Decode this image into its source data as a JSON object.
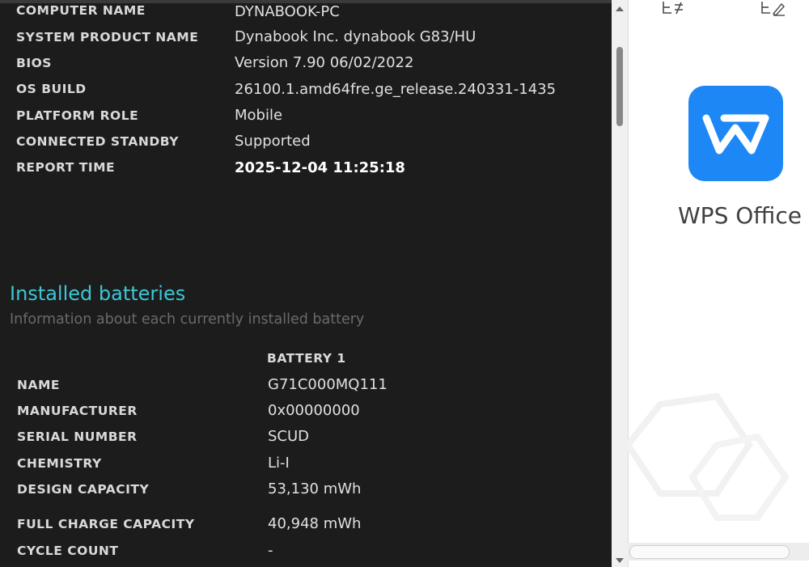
{
  "system_info": [
    {
      "label": "COMPUTER NAME",
      "value": "DYNABOOK-PC"
    },
    {
      "label": "SYSTEM PRODUCT NAME",
      "value": "Dynabook Inc. dynabook G83/HU"
    },
    {
      "label": "BIOS",
      "value": "Version 7.90 06/02/2022"
    },
    {
      "label": "OS BUILD",
      "value": "26100.1.amd64fre.ge_release.240331-1435"
    },
    {
      "label": "PLATFORM ROLE",
      "value": "Mobile"
    },
    {
      "label": "CONNECTED STANDBY",
      "value": "Supported"
    },
    {
      "label": "REPORT TIME",
      "value": "2025-12-04  11:25:18"
    }
  ],
  "batteries": {
    "title": "Installed batteries",
    "subtitle": "Information about each currently installed battery",
    "column_header": "BATTERY 1",
    "rows": [
      {
        "label": "NAME",
        "value": "G71C000MQ111"
      },
      {
        "label": "MANUFACTURER",
        "value": "0x00000000"
      },
      {
        "label": "SERIAL NUMBER",
        "value": "SCUD"
      },
      {
        "label": "CHEMISTRY",
        "value": "Li-I"
      },
      {
        "label": "DESIGN CAPACITY",
        "value": "53,130 mWh"
      },
      {
        "label": "FULL CHARGE CAPACITY",
        "value": "40,948 mWh"
      },
      {
        "label": "CYCLE COUNT",
        "value": "-"
      }
    ]
  },
  "side_panel": {
    "app_name": "WPS Office",
    "logo_color": "#1d88f5",
    "icons": [
      "edit-list-icon",
      "edit-note-icon"
    ]
  },
  "colors": {
    "background": "#1c1c1c",
    "accent": "#3ac7d8",
    "subtitle": "#6a6a6a"
  }
}
